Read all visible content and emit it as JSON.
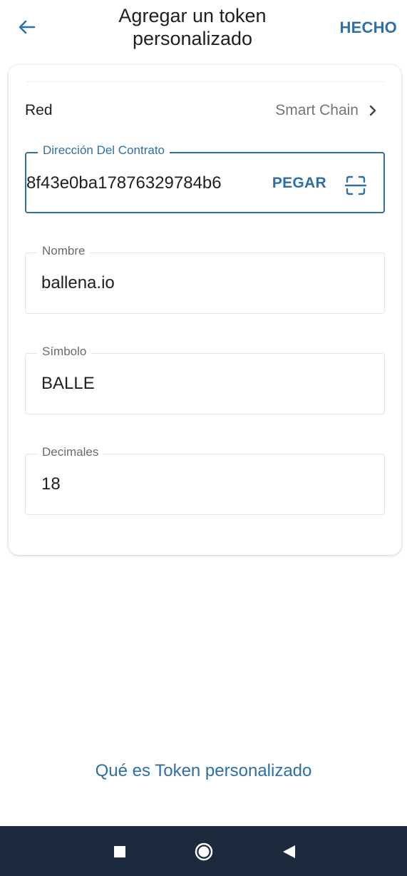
{
  "header": {
    "title": "Agregar un token personalizado",
    "done_label": "HECHO",
    "back_icon": "arrow-left-icon"
  },
  "network": {
    "label": "Red",
    "value": "Smart Chain",
    "chevron_icon": "chevron-right-icon"
  },
  "fields": {
    "contract": {
      "label": "Dirección Del Contrato",
      "value": "8f43e0ba17876329784b6",
      "paste_label": "PEGAR",
      "scan_icon": "qr-scan-icon"
    },
    "name": {
      "label": "Nombre",
      "value": "ballena.io"
    },
    "symbol": {
      "label": "Símbolo",
      "value": "BALLE"
    },
    "decimals": {
      "label": "Decimales",
      "value": "18"
    }
  },
  "help": {
    "link_label": "Qué es Token personalizado"
  },
  "system_nav": {
    "recents_icon": "square-icon",
    "home_icon": "circle-icon",
    "back_icon": "triangle-back-icon"
  },
  "colors": {
    "accent": "#2f6fa7",
    "navbar": "#1d2a3d",
    "muted_text": "#757575"
  }
}
